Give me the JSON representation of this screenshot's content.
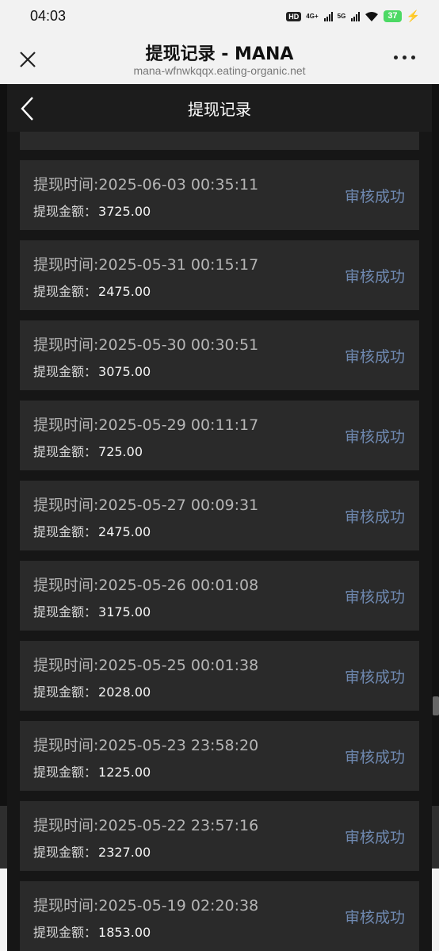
{
  "status_bar": {
    "time": "04:03",
    "hd_label": "HD",
    "net_4g": "4G+",
    "net_5g": "5G",
    "battery": "37"
  },
  "browser": {
    "title": "提现记录 - MANA",
    "url": "mana-wfnwkqqx.eating-organic.net"
  },
  "modal": {
    "title": "提现记录"
  },
  "labels": {
    "time_label": "提现时间:",
    "amount_label": "提现金额："
  },
  "records": [
    {
      "time": "",
      "amount": "",
      "status": ""
    },
    {
      "time": "2025-06-03 00:35:11",
      "amount": "3725.00",
      "status": "审核成功"
    },
    {
      "time": "2025-05-31 00:15:17",
      "amount": "2475.00",
      "status": "审核成功"
    },
    {
      "time": "2025-05-30 00:30:51",
      "amount": "3075.00",
      "status": "审核成功"
    },
    {
      "time": "2025-05-29 00:11:17",
      "amount": "725.00",
      "status": "审核成功"
    },
    {
      "time": "2025-05-27 00:09:31",
      "amount": "2475.00",
      "status": "审核成功"
    },
    {
      "time": "2025-05-26 00:01:08",
      "amount": "3175.00",
      "status": "审核成功"
    },
    {
      "time": "2025-05-25 00:01:38",
      "amount": "2028.00",
      "status": "审核成功"
    },
    {
      "time": "2025-05-23 23:58:20",
      "amount": "1225.00",
      "status": "审核成功"
    },
    {
      "time": "2025-05-22 23:57:16",
      "amount": "2327.00",
      "status": "审核成功"
    },
    {
      "time": "2025-05-19 02:20:38",
      "amount": "1853.00",
      "status": "审核成功"
    }
  ]
}
